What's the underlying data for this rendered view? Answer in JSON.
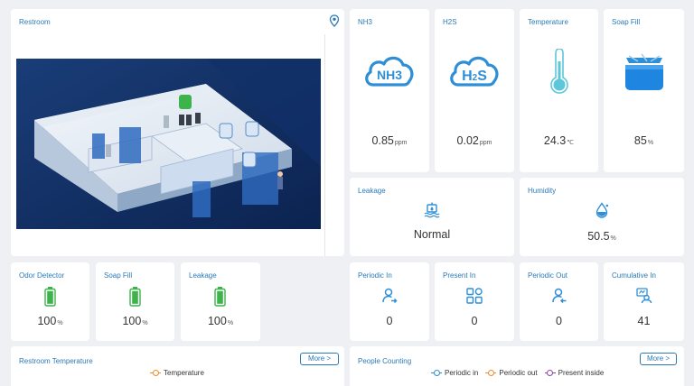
{
  "restroom": {
    "title": "Restroom",
    "location_icon": "map-pin-icon"
  },
  "sensors": [
    {
      "title": "NH3",
      "icon": "nh3-cloud-icon",
      "value": "0.85",
      "unit": "ppm"
    },
    {
      "title": "H2S",
      "icon": "h2s-cloud-icon",
      "value": "0.02",
      "unit": "ppm"
    },
    {
      "title": "Temperature",
      "icon": "thermometer-icon",
      "value": "24.3",
      "unit": "℃"
    },
    {
      "title": "Soap Fill",
      "icon": "soap-container-icon",
      "value": "85",
      "unit": "%"
    }
  ],
  "leakage": {
    "title": "Leakage",
    "icon": "water-leak-icon",
    "status": "Normal"
  },
  "humidity": {
    "title": "Humidity",
    "icon": "water-drop-icon",
    "value": "50.5",
    "unit": "%"
  },
  "batteries": [
    {
      "title": "Odor Detector",
      "value": "100",
      "unit": "%",
      "level": 1.0
    },
    {
      "title": "Soap Fill",
      "value": "100",
      "unit": "%",
      "level": 1.0
    },
    {
      "title": "Leakage",
      "value": "100",
      "unit": "%",
      "level": 1.0
    }
  ],
  "people": [
    {
      "title": "Periodic In",
      "icon": "person-in-icon",
      "value": "0"
    },
    {
      "title": "Present In",
      "icon": "grid-squares-icon",
      "value": "0"
    },
    {
      "title": "Periodic Out",
      "icon": "person-out-icon",
      "value": "0"
    },
    {
      "title": "Cumulative In",
      "icon": "people-count-icon",
      "value": "41"
    }
  ],
  "temp_chart": {
    "title": "Restroom Temperature",
    "more": "More >",
    "legend": [
      "Temperature"
    ]
  },
  "people_chart": {
    "title": "People Counting",
    "more": "More >",
    "legend": [
      "Periodic in",
      "Periodic out",
      "Present inside"
    ]
  },
  "colors": {
    "accent": "#2a7ab8",
    "icon_blue": "#2f8fd6",
    "battery_green": "#3cb44b",
    "thermo": "#5cc7d9",
    "legend_temperature": "#f08a24",
    "legend_periodic_in": "#2a8fc9",
    "legend_periodic_out": "#f08a24",
    "legend_present_inside": "#8e44ad"
  }
}
